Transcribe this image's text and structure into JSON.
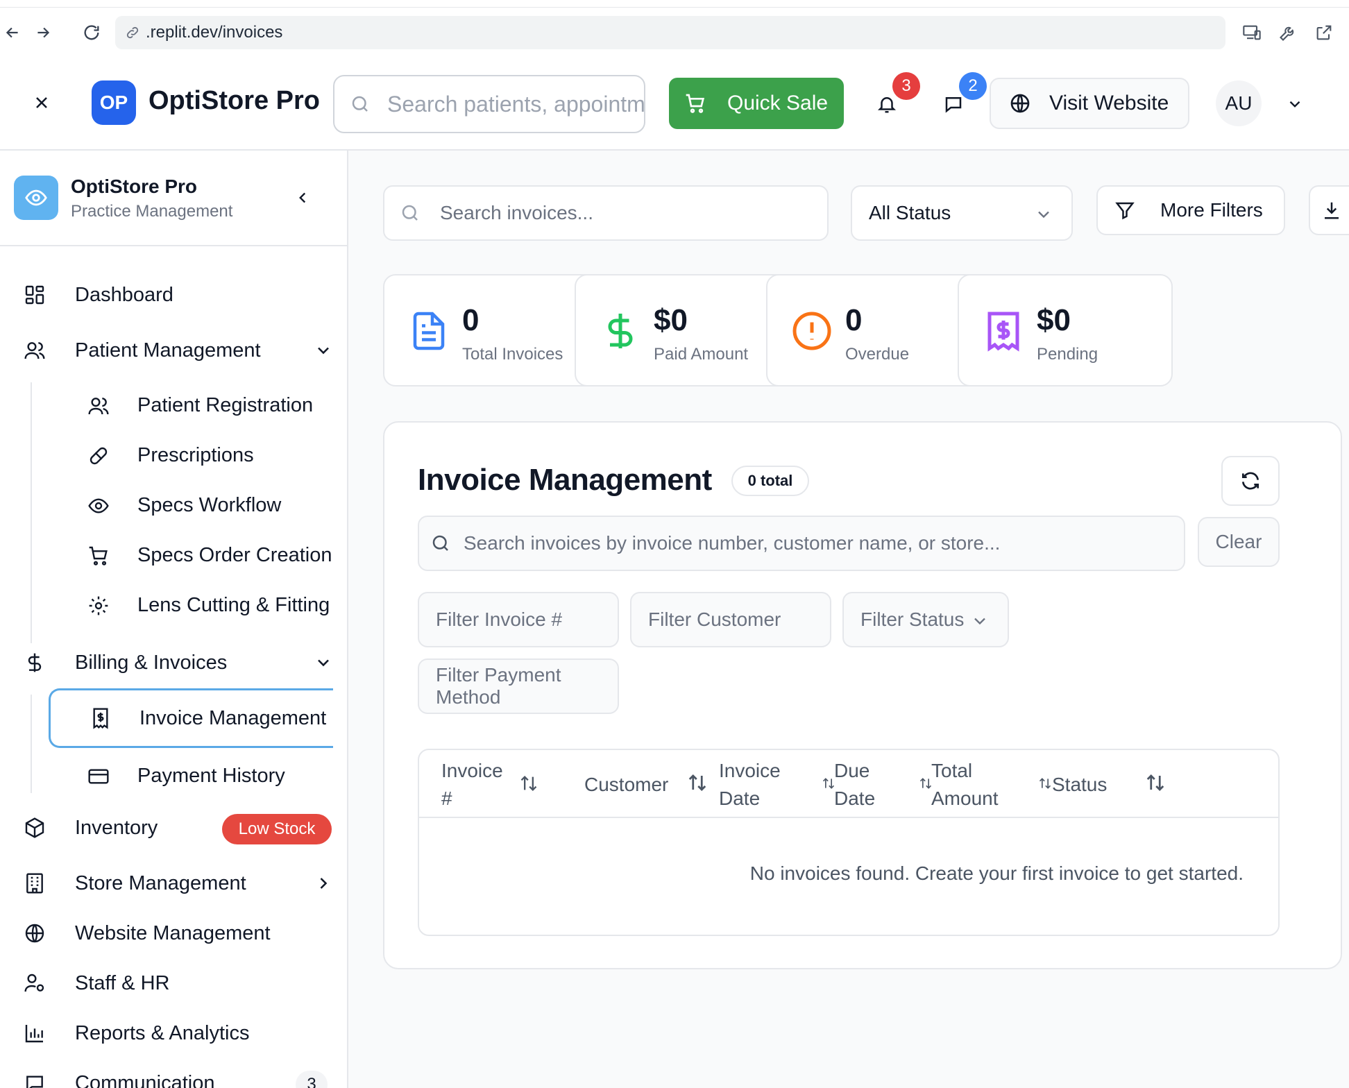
{
  "browser": {
    "url": ".replit.dev/invoices"
  },
  "header": {
    "logo_initials": "OP",
    "app_title": "OptiStore Pro",
    "search_placeholder": "Search patients, appointments...",
    "quick_sale_label": "Quick Sale",
    "notifications_count": "3",
    "messages_count": "2",
    "visit_website_label": "Visit Website",
    "user_initials": "AU"
  },
  "sidebar": {
    "brand_title": "OptiStore Pro",
    "brand_subtitle": "Practice Management",
    "items": {
      "dashboard": "Dashboard",
      "patient_management": "Patient Management",
      "patient_registration": "Patient Registration",
      "prescriptions": "Prescriptions",
      "specs_workflow": "Specs Workflow",
      "specs_order_creation": "Specs Order Creation",
      "lens_cutting": "Lens Cutting & Fitting",
      "billing_invoices": "Billing & Invoices",
      "invoice_management": "Invoice Management",
      "payment_history": "Payment History",
      "inventory": "Inventory",
      "inventory_badge": "Low Stock",
      "store_management": "Store Management",
      "website_management": "Website Management",
      "staff_hr": "Staff & HR",
      "reports_analytics": "Reports & Analytics",
      "communication": "Communication",
      "communication_count": "3"
    }
  },
  "main": {
    "search_placeholder": "Search invoices...",
    "status_filter": "All Status",
    "more_filters_label": "More Filters",
    "stats": [
      {
        "value": "0",
        "caption": "Total Invoices"
      },
      {
        "value": "$0",
        "caption": "Paid Amount"
      },
      {
        "value": "0",
        "caption": "Overdue"
      },
      {
        "value": "$0",
        "caption": "Pending"
      }
    ],
    "panel": {
      "title": "Invoice Management",
      "total_badge": "0 total",
      "search_placeholder": "Search invoices by invoice number, customer name, or store...",
      "clear_label": "Clear",
      "filter_invoice": "Filter Invoice #",
      "filter_customer": "Filter Customer",
      "filter_status": "Filter Status",
      "filter_payment": "Filter Payment Method",
      "columns": {
        "invoice_1": "Invoice",
        "invoice_2": "#",
        "customer": "Customer",
        "invoice_date_1": "Invoice",
        "invoice_date_2": "Date",
        "due_date_1": "Due",
        "due_date_2": "Date",
        "total_amount_1": "Total",
        "total_amount_2": "Amount",
        "status": "Status"
      },
      "empty_message": "No invoices found. Create your first invoice to get started."
    }
  },
  "colors": {
    "primary": "#2563eb",
    "quick_sale": "#3ca14b",
    "badge_red": "#e53e3e",
    "badge_blue": "#3b82f6",
    "low_stock": "#e5483f",
    "active_border": "#5aa9e6"
  }
}
